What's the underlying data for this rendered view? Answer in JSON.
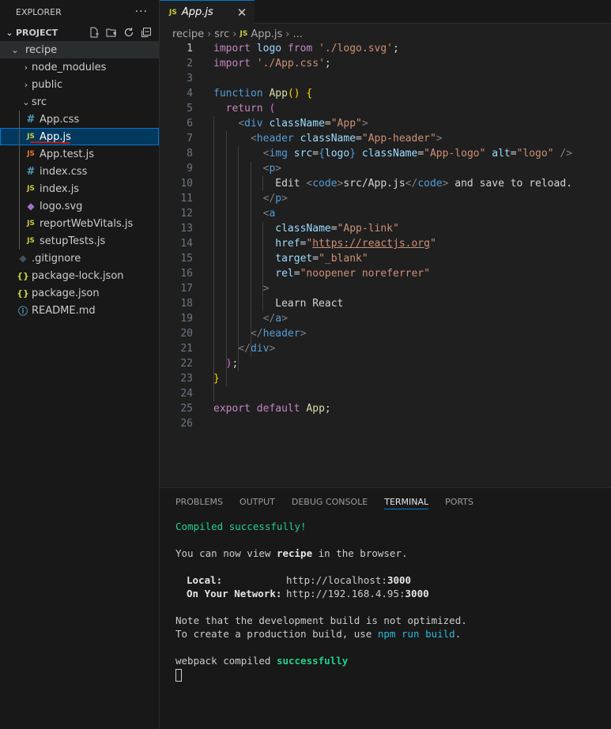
{
  "sidebar": {
    "title": "EXPLORER",
    "more": "···",
    "section": "PROJECT",
    "tree": [
      {
        "label": "recipe",
        "type": "folder-open",
        "icon": "",
        "depth": 0
      },
      {
        "label": "node_modules",
        "type": "folder",
        "icon": "",
        "depth": 1
      },
      {
        "label": "public",
        "type": "folder",
        "icon": "",
        "depth": 1
      },
      {
        "label": "src",
        "type": "folder-open",
        "icon": "",
        "depth": 1
      },
      {
        "label": "App.css",
        "type": "file",
        "icon": "#",
        "depth": 2
      },
      {
        "label": "App.js",
        "type": "file",
        "icon": "JS",
        "depth": 2
      },
      {
        "label": "App.test.js",
        "type": "file",
        "icon": "JS",
        "depth": 2
      },
      {
        "label": "index.css",
        "type": "file",
        "icon": "#",
        "depth": 2
      },
      {
        "label": "index.js",
        "type": "file",
        "icon": "JS",
        "depth": 2
      },
      {
        "label": "logo.svg",
        "type": "file",
        "icon": "◆",
        "depth": 2
      },
      {
        "label": "reportWebVitals.js",
        "type": "file",
        "icon": "JS",
        "depth": 2
      },
      {
        "label": "setupTests.js",
        "type": "file",
        "icon": "JS",
        "depth": 2
      },
      {
        "label": ".gitignore",
        "type": "file",
        "icon": "◆",
        "depth": 1
      },
      {
        "label": "package-lock.json",
        "type": "file",
        "icon": "{}",
        "depth": 1
      },
      {
        "label": "package.json",
        "type": "file",
        "icon": "{}",
        "depth": 1
      },
      {
        "label": "README.md",
        "type": "file",
        "icon": "ⓘ",
        "depth": 1
      }
    ]
  },
  "editor": {
    "tab": {
      "icon": "JS",
      "label": "App.js",
      "close": "✕"
    },
    "breadcrumb": {
      "p1": "recipe",
      "p2": "src",
      "icon": "JS",
      "p3": "App.js",
      "p4": "..."
    },
    "line_numbers": [
      "1",
      "2",
      "3",
      "4",
      "5",
      "6",
      "7",
      "8",
      "9",
      "10",
      "11",
      "12",
      "13",
      "14",
      "15",
      "16",
      "17",
      "18",
      "19",
      "20",
      "21",
      "22",
      "23",
      "24",
      "25",
      "26"
    ]
  },
  "panel": {
    "tabs": [
      "PROBLEMS",
      "OUTPUT",
      "DEBUG CONSOLE",
      "TERMINAL",
      "PORTS"
    ],
    "terminal": {
      "compiled": "Compiled successfully!",
      "view_pre": "You can now view ",
      "view_app": "recipe",
      "view_post": " in the browser.",
      "local_label": "Local:",
      "local_url_pre": "http://localhost:",
      "local_port": "3000",
      "network_label": "On Your Network:",
      "network_url_pre": "http://192.168.4.95:",
      "network_port": "3000",
      "note1": "Note that the development build is not optimized.",
      "note2_pre": "To create a production build, use ",
      "note2_cmd": "npm run build",
      "note2_post": ".",
      "webpack_pre": "webpack compiled ",
      "webpack_status": "successfully"
    }
  },
  "colors": {
    "accent": "#0078d4",
    "selection": "#04395e",
    "annotation": "#e51400"
  }
}
